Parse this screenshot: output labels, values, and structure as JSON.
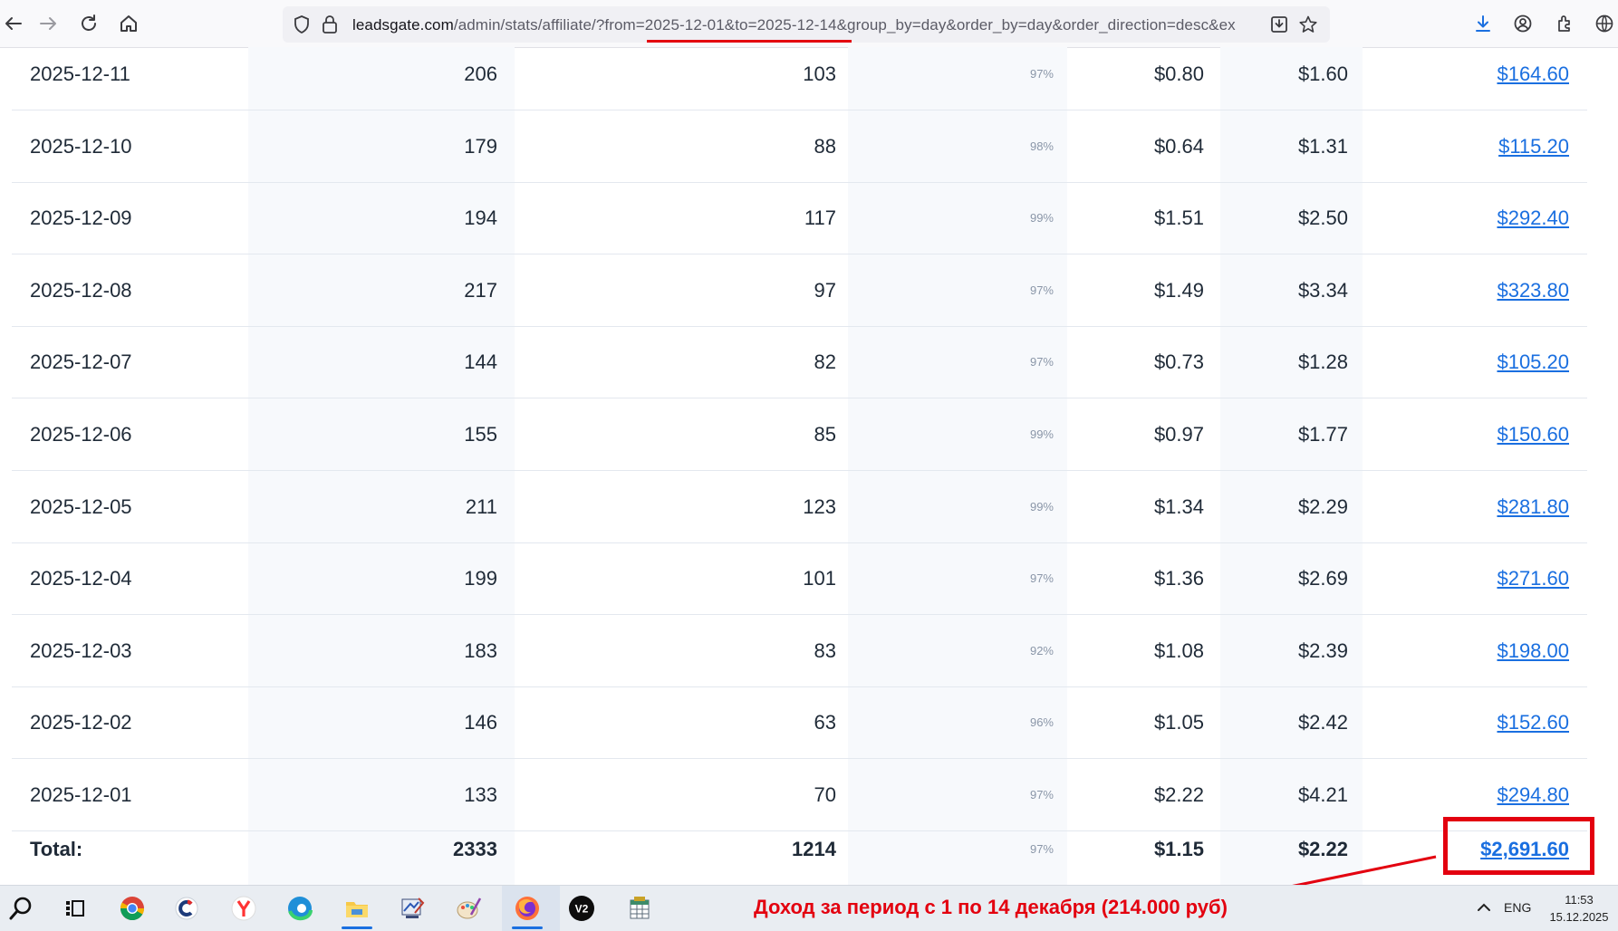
{
  "browser": {
    "url_host": "leadsgate.com",
    "url_path": "/admin/stats/affiliate/?from=2025-12-01&to=2025-12-14&group_by=day&order_by=day&order_direction=desc&ex"
  },
  "table": {
    "rows": [
      {
        "date": "2025-12-11",
        "clicks": "206",
        "leads": "103",
        "pct": "97%",
        "epc": "$0.80",
        "epl": "$1.60",
        "revenue": "$164.60"
      },
      {
        "date": "2025-12-10",
        "clicks": "179",
        "leads": "88",
        "pct": "98%",
        "epc": "$0.64",
        "epl": "$1.31",
        "revenue": "$115.20"
      },
      {
        "date": "2025-12-09",
        "clicks": "194",
        "leads": "117",
        "pct": "99%",
        "epc": "$1.51",
        "epl": "$2.50",
        "revenue": "$292.40"
      },
      {
        "date": "2025-12-08",
        "clicks": "217",
        "leads": "97",
        "pct": "97%",
        "epc": "$1.49",
        "epl": "$3.34",
        "revenue": "$323.80"
      },
      {
        "date": "2025-12-07",
        "clicks": "144",
        "leads": "82",
        "pct": "97%",
        "epc": "$0.73",
        "epl": "$1.28",
        "revenue": "$105.20"
      },
      {
        "date": "2025-12-06",
        "clicks": "155",
        "leads": "85",
        "pct": "99%",
        "epc": "$0.97",
        "epl": "$1.77",
        "revenue": "$150.60"
      },
      {
        "date": "2025-12-05",
        "clicks": "211",
        "leads": "123",
        "pct": "99%",
        "epc": "$1.34",
        "epl": "$2.29",
        "revenue": "$281.80"
      },
      {
        "date": "2025-12-04",
        "clicks": "199",
        "leads": "101",
        "pct": "97%",
        "epc": "$1.36",
        "epl": "$2.69",
        "revenue": "$271.60"
      },
      {
        "date": "2025-12-03",
        "clicks": "183",
        "leads": "83",
        "pct": "92%",
        "epc": "$1.08",
        "epl": "$2.39",
        "revenue": "$198.00"
      },
      {
        "date": "2025-12-02",
        "clicks": "146",
        "leads": "63",
        "pct": "96%",
        "epc": "$1.05",
        "epl": "$2.42",
        "revenue": "$152.60"
      },
      {
        "date": "2025-12-01",
        "clicks": "133",
        "leads": "70",
        "pct": "97%",
        "epc": "$2.22",
        "epl": "$4.21",
        "revenue": "$294.80"
      }
    ],
    "total": {
      "label": "Total:",
      "clicks": "2333",
      "leads": "1214",
      "pct": "97%",
      "epc": "$1.15",
      "epl": "$2.22",
      "revenue": "$2,691.60"
    }
  },
  "annotation": {
    "text": "Доход за период с 1 по 14 декабря (214.000 руб)",
    "color": "#e3000f"
  },
  "taskbar": {
    "icons": [
      "search-icon",
      "task-view-icon",
      "chrome-icon",
      "ccleaner-icon",
      "yandex-browser-icon",
      "edge-icon",
      "file-explorer-icon",
      "app-icon",
      "paint-icon",
      "firefox-icon",
      "v2-icon",
      "spreadsheet-icon"
    ],
    "language": "ENG",
    "time": "11:53",
    "date": "15.12.2025"
  },
  "colors": {
    "link": "#1a6fe0",
    "accent_red": "#e3000f"
  }
}
